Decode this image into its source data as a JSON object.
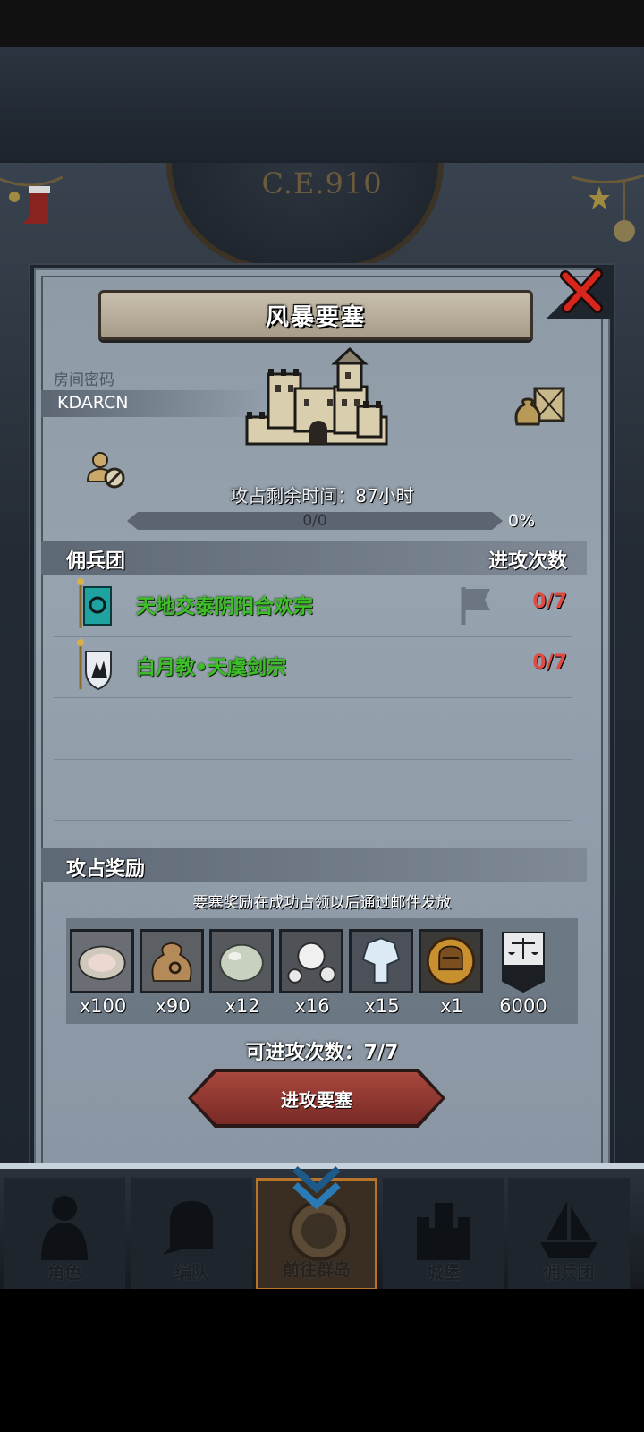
{
  "background": {
    "era": "C.E.910"
  },
  "dialog": {
    "title": "风暴要塞",
    "room": {
      "label": "房间密码",
      "code": "KDARCN"
    },
    "timer": {
      "label": "攻占剩余时间：",
      "hours": "87",
      "unit": "小时"
    },
    "progress": {
      "text": "0/0",
      "percent_text": "0%",
      "fraction": 0
    },
    "mercenary": {
      "header_left": "佣兵团",
      "header_right": "进攻次数",
      "rows": [
        {
          "name": "天地交泰阴阳合欢宗",
          "count": "0/7"
        },
        {
          "name": "白月教•天虞剑宗",
          "count": "0/7"
        }
      ]
    },
    "rewards": {
      "header": "攻占奖励",
      "note": "要塞奖励在成功占领以后通过邮件发放",
      "items": [
        {
          "icon": "oyster-icon",
          "qty": "x100"
        },
        {
          "icon": "pouch-icon",
          "qty": "x90"
        },
        {
          "icon": "stone-icon",
          "qty": "x12"
        },
        {
          "icon": "pearl-icon",
          "qty": "x16"
        },
        {
          "icon": "crystal-icon",
          "qty": "x15"
        },
        {
          "icon": "helmet-coin-icon",
          "qty": "x1"
        },
        {
          "icon": "justice-banner-icon",
          "qty": "6000"
        }
      ]
    },
    "attacks_left": "可进攻次数：7/7",
    "attack_button": "进攻要塞"
  },
  "nav": [
    {
      "label": "角色"
    },
    {
      "label": "编队"
    },
    {
      "label": "前往群岛"
    },
    {
      "label": "城堡"
    },
    {
      "label": "佣兵团"
    }
  ],
  "colors": {
    "accent_red": "#e14a40",
    "guild_green": "#3fbf2a",
    "button_red": "#a8473e"
  }
}
